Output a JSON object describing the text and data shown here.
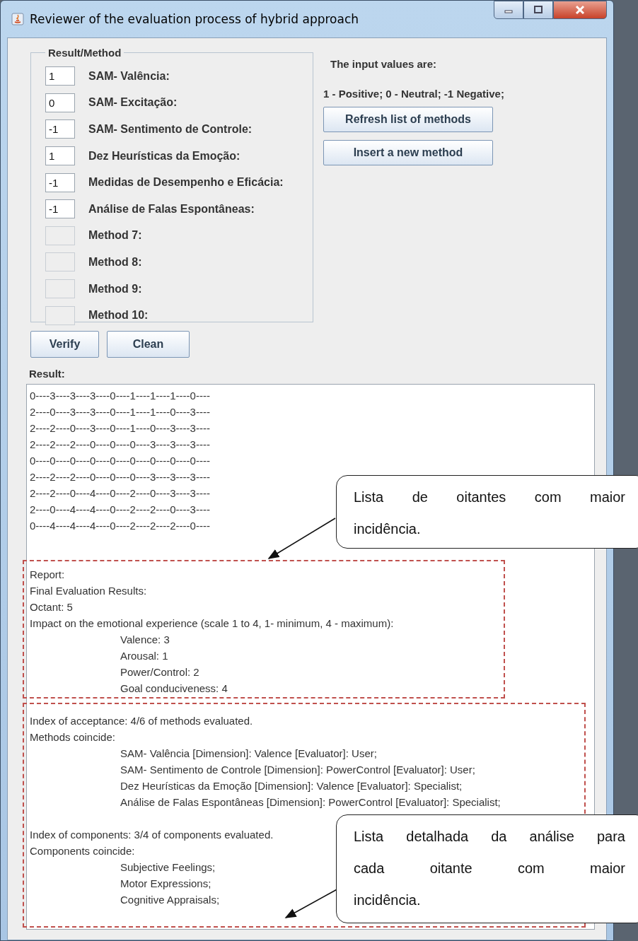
{
  "window": {
    "title": "Reviewer of the evaluation process of hybrid approach"
  },
  "methods_group": {
    "title": "Result/Method",
    "methods": [
      {
        "value": "1",
        "label": "SAM- Valência:"
      },
      {
        "value": "0",
        "label": "SAM- Excitação:"
      },
      {
        "value": "-1",
        "label": "SAM- Sentimento de Controle:"
      },
      {
        "value": "1",
        "label": "Dez Heurísticas da Emoção:"
      },
      {
        "value": "-1",
        "label": "Medidas de Desempenho e Eficácia:"
      },
      {
        "value": "-1",
        "label": "Análise de Falas Espontâneas:"
      },
      {
        "label": "Method 7:"
      },
      {
        "label": "Method 8:"
      },
      {
        "label": "Method 9:"
      },
      {
        "label": "Method 10:"
      }
    ]
  },
  "info": {
    "heading": "The input values are:",
    "legend": "1 - Positive; 0 - Neutral; -1 Negative;"
  },
  "side_buttons": [
    "Refresh list of methods",
    "Insert a new method"
  ],
  "action_buttons": [
    "Verify",
    "Clean"
  ],
  "result": {
    "label": "Result:",
    "blocks": [
      {
        "lines": [
          {
            "kind": "plain",
            "text": "0----3----3----3----0----1----1----1----0----"
          },
          {
            "kind": "plain",
            "text": "2----0----3----3----0----1----1----0----3----"
          },
          {
            "kind": "plain",
            "text": "2----2----0----3----0----1----0----3----3----"
          },
          {
            "kind": "plain",
            "text": "2----2----2----0----0----0----3----3----3----"
          },
          {
            "kind": "plain",
            "text": "0----0----0----0----0----0----0----0----0----"
          },
          {
            "kind": "plain",
            "text": "2----2----2----0----0----0----3----3----3----"
          },
          {
            "kind": "plain",
            "text": "2----2----0----4----0----2----0----3----3----"
          },
          {
            "kind": "plain",
            "text": "2----0----4----4----0----2----2----0----3----"
          },
          {
            "kind": "plain",
            "text": "0----4----4----4----0----2----2----2----0----"
          }
        ]
      },
      {
        "lines": [
          {
            "kind": "plain",
            "text": "Report:"
          },
          {
            "kind": "plain",
            "text": "Final Evaluation Results:"
          },
          {
            "kind": "plain",
            "text": "Octant: 5"
          },
          {
            "kind": "plain",
            "text": "Impact on the emotional experience (scale 1 to 4, 1- minimum, 4 - maximum):"
          },
          {
            "kind": "indented",
            "text": "Valence: 3"
          },
          {
            "kind": "indented",
            "text": "Arousal: 1"
          },
          {
            "kind": "indented",
            "text": "Power/Control: 2"
          },
          {
            "kind": "indented",
            "text": "Goal conduciveness: 4"
          }
        ]
      },
      {
        "lines": [
          {
            "kind": "plain",
            "text": "Index of acceptance: 4/6 of methods evaluated."
          },
          {
            "kind": "plain",
            "text": "Methods coincide:"
          },
          {
            "kind": "indented",
            "text": "SAM- Valência [Dimension]: Valence [Evaluator]: User;"
          },
          {
            "kind": "indented",
            "text": "SAM- Sentimento de Controle [Dimension]: PowerControl [Evaluator]: User;"
          },
          {
            "kind": "indented",
            "text": "Dez Heurísticas da Emoção [Dimension]: Valence [Evaluator]: Specialist;"
          },
          {
            "kind": "indented",
            "text": "Análise de Falas Espontâneas [Dimension]: PowerControl [Evaluator]: Specialist;"
          }
        ]
      },
      {
        "lines": [
          {
            "kind": "plain",
            "text": "Index of components: 3/4 of components evaluated."
          },
          {
            "kind": "plain",
            "text": "Components coincide:"
          },
          {
            "kind": "indented",
            "text": "Subjective Feelings;"
          },
          {
            "kind": "indented",
            "text": "Motor Expressions;"
          },
          {
            "kind": "indented",
            "text": "Cognitive Appraisals;"
          }
        ]
      }
    ]
  },
  "annotations": [
    {
      "words": [
        "Lista",
        "de",
        "oitantes",
        "com",
        "maior"
      ],
      "last_line": "incidência."
    },
    {
      "words": [
        "Lista",
        "detalhada",
        "da",
        "análise",
        "para"
      ],
      "middle_words": [
        "cada",
        "oitante",
        "com",
        "maior"
      ],
      "last_line": "incidência."
    }
  ]
}
